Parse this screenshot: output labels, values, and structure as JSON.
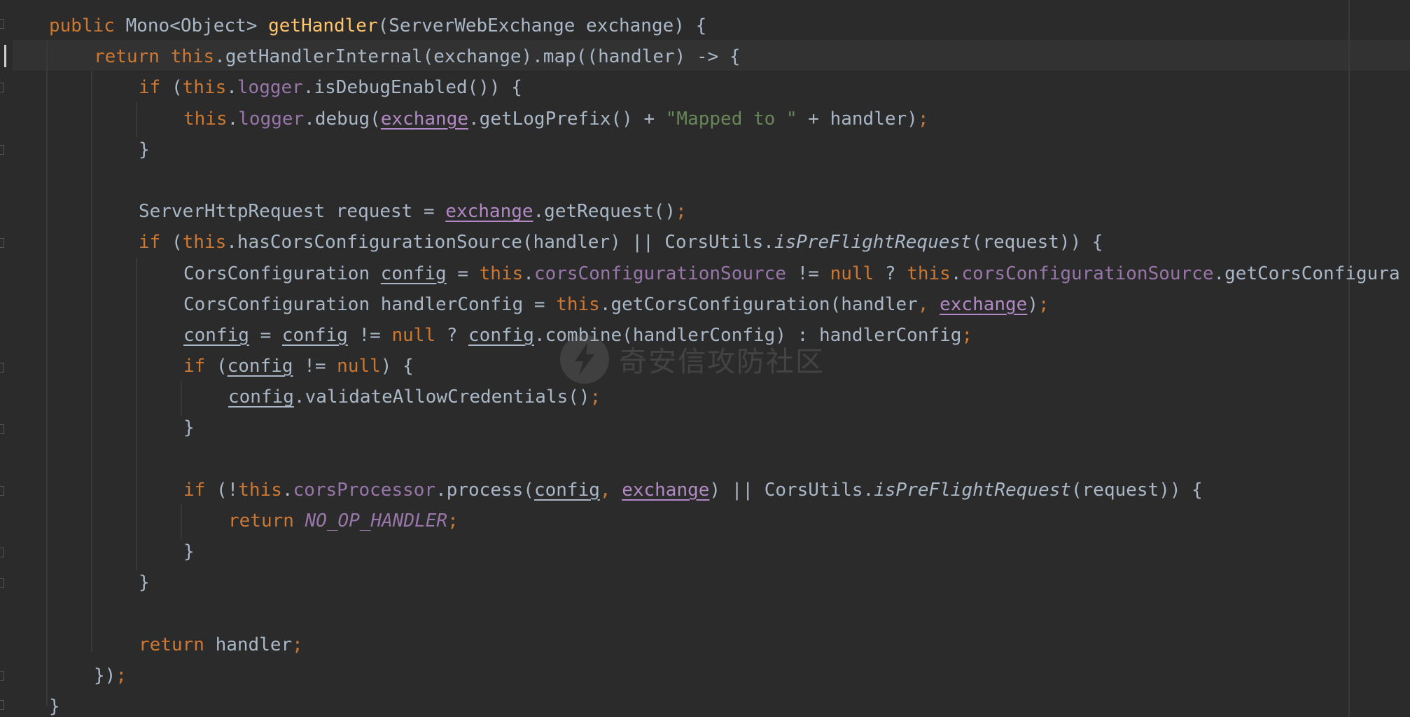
{
  "editor": {
    "watermark": "奇安信攻防社区",
    "lines": [
      [
        "public",
        " Mono<Object> ",
        "getHandler",
        "(ServerWebExchange exchange) {"
      ],
      [
        "return",
        " ",
        "this",
        ".getHandlerInternal(exchange).map((handler) -> {"
      ],
      [
        "if",
        " (",
        "this",
        ".",
        "logger",
        ".isDebugEnabled()) {"
      ],
      [
        "this",
        ".",
        "logger",
        ".debug(",
        "exchange",
        ".getLogPrefix() + ",
        "\"Mapped to \"",
        " + handler)",
        ";"
      ],
      [
        "}"
      ],
      [
        ""
      ],
      [
        "ServerHttpRequest request = ",
        "exchange",
        ".getRequest()",
        ";"
      ],
      [
        "if",
        " (",
        "this",
        ".hasCorsConfigurationSource(handler) || CorsUtils.",
        "isPreFlightRequest",
        "(request)) {"
      ],
      [
        "CorsConfiguration ",
        "config",
        " = ",
        "this",
        ".",
        "corsConfigurationSource",
        " != ",
        "null",
        " ? ",
        "this",
        ".",
        "corsConfigurationSource",
        ".getCorsConfigura"
      ],
      [
        "CorsConfiguration handlerConfig = ",
        "this",
        ".getCorsConfiguration(handler",
        ",",
        " ",
        "exchange",
        ")",
        ";"
      ],
      [
        "config",
        " = ",
        "config",
        " != ",
        "null",
        " ? ",
        "config",
        ".combine(handlerConfig) : handlerConfig",
        ";"
      ],
      [
        "if",
        " (",
        "config",
        " != ",
        "null",
        ") {"
      ],
      [
        "config",
        ".validateAllowCredentials()",
        ";"
      ],
      [
        "}"
      ],
      [
        ""
      ],
      [
        "if",
        " (!",
        "this",
        ".",
        "corsProcessor",
        ".process(",
        "config",
        ",",
        " ",
        "exchange",
        ") || CorsUtils.",
        "isPreFlightRequest",
        "(request)) {"
      ],
      [
        "return",
        " ",
        "NO_OP_HANDLER",
        ";"
      ],
      [
        "}"
      ],
      [
        "}"
      ],
      [
        ""
      ],
      [
        "return",
        " handler",
        ";"
      ],
      [
        "})",
        ";"
      ],
      [
        "}"
      ]
    ]
  }
}
